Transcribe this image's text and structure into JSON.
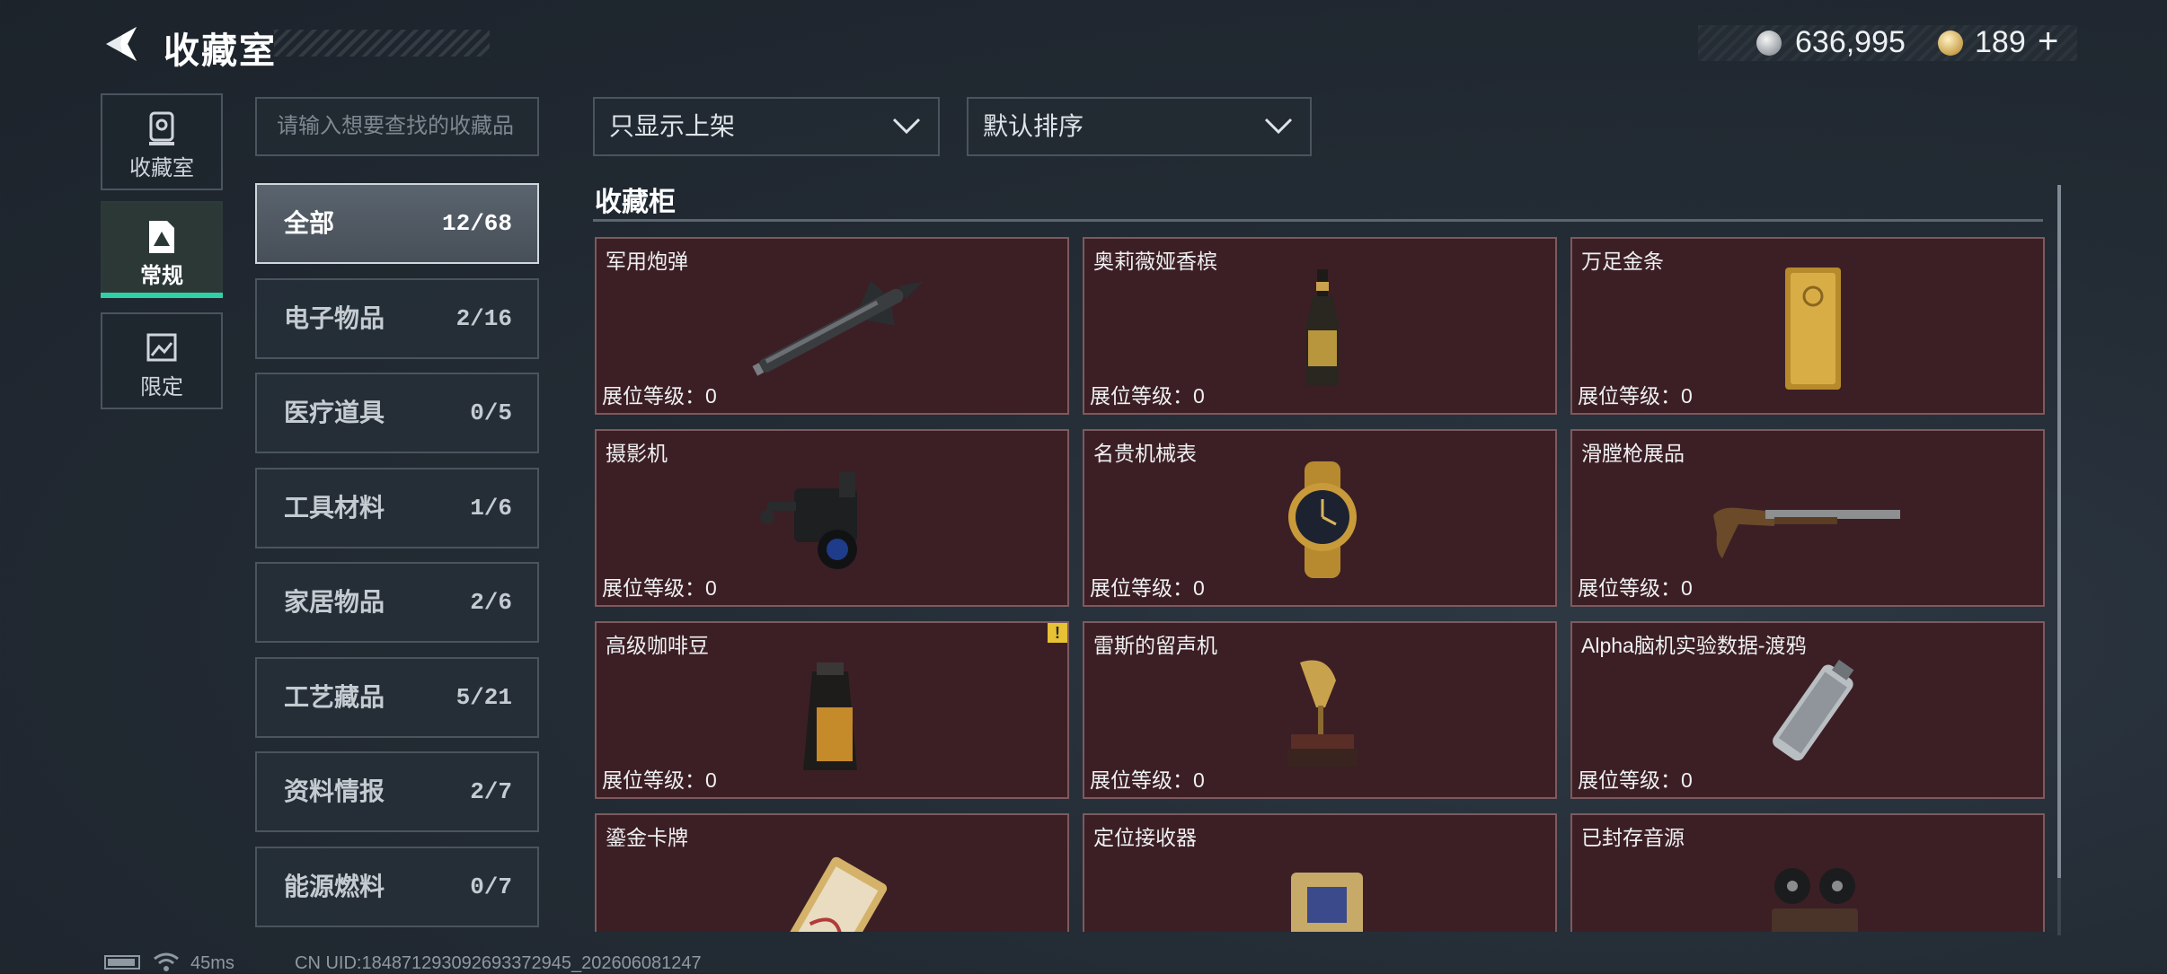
{
  "header": {
    "title": "收藏室",
    "back_icon": "back-arrow-icon",
    "currency": [
      {
        "icon": "silver-coin-icon",
        "value": "636,995"
      },
      {
        "icon": "gold-coin-icon",
        "value": "189"
      }
    ],
    "add_label": "+"
  },
  "nav": [
    {
      "label": "收藏室",
      "icon": "trophy-icon"
    },
    {
      "label": "常规",
      "icon": "card-icon",
      "active": true
    },
    {
      "label": "限定",
      "icon": "image-icon"
    }
  ],
  "search": {
    "placeholder": "请输入想要查找的收藏品"
  },
  "categories": [
    {
      "label": "全部",
      "count": "12/68",
      "active": true
    },
    {
      "label": "电子物品",
      "count": "2/16"
    },
    {
      "label": "医疗道具",
      "count": "0/5"
    },
    {
      "label": "工具材料",
      "count": "1/6"
    },
    {
      "label": "家居物品",
      "count": "2/6"
    },
    {
      "label": "工艺藏品",
      "count": "5/21"
    },
    {
      "label": "资料情报",
      "count": "2/7"
    },
    {
      "label": "能源燃料",
      "count": "0/7"
    }
  ],
  "filters": {
    "shelf_filter": "只显示上架",
    "sort": "默认排序",
    "dropdown_icon": "chevron-down-icon"
  },
  "cabinet": {
    "title": "收藏柜",
    "items": [
      {
        "name": "军用炮弹",
        "level": "展位等级：0",
        "icon": "missile-icon"
      },
      {
        "name": "奥莉薇娅香槟",
        "level": "展位等级：0",
        "icon": "champagne-bottle-icon"
      },
      {
        "name": "万足金条",
        "level": "展位等级：0",
        "icon": "gold-bar-icon"
      },
      {
        "name": "摄影机",
        "level": "展位等级：0",
        "icon": "camera-icon"
      },
      {
        "name": "名贵机械表",
        "level": "展位等级：0",
        "icon": "watch-icon"
      },
      {
        "name": "滑膛枪展品",
        "level": "展位等级：0",
        "icon": "musket-icon"
      },
      {
        "name": "高级咖啡豆",
        "level": "展位等级：0",
        "icon": "coffee-bag-icon",
        "warning": "!"
      },
      {
        "name": "雷斯的留声机",
        "level": "展位等级：0",
        "icon": "gramophone-icon"
      },
      {
        "name": "Alpha脑机实验数据-渡鸦",
        "level": "展位等级：0",
        "icon": "data-canister-icon"
      },
      {
        "name": "鎏金卡牌",
        "level": "",
        "icon": "gilded-card-icon"
      },
      {
        "name": "定位接收器",
        "level": "",
        "icon": "receiver-icon"
      },
      {
        "name": "已封存音源",
        "level": "",
        "icon": "tape-recorder-icon"
      }
    ]
  },
  "footer": {
    "ping": "45ms",
    "uid": "CN UID:18487129309269337​2945_202606081247"
  },
  "colors": {
    "accent": "#2fd0a6",
    "card_bg": "#3c1f25",
    "warning": "#e6c234"
  }
}
